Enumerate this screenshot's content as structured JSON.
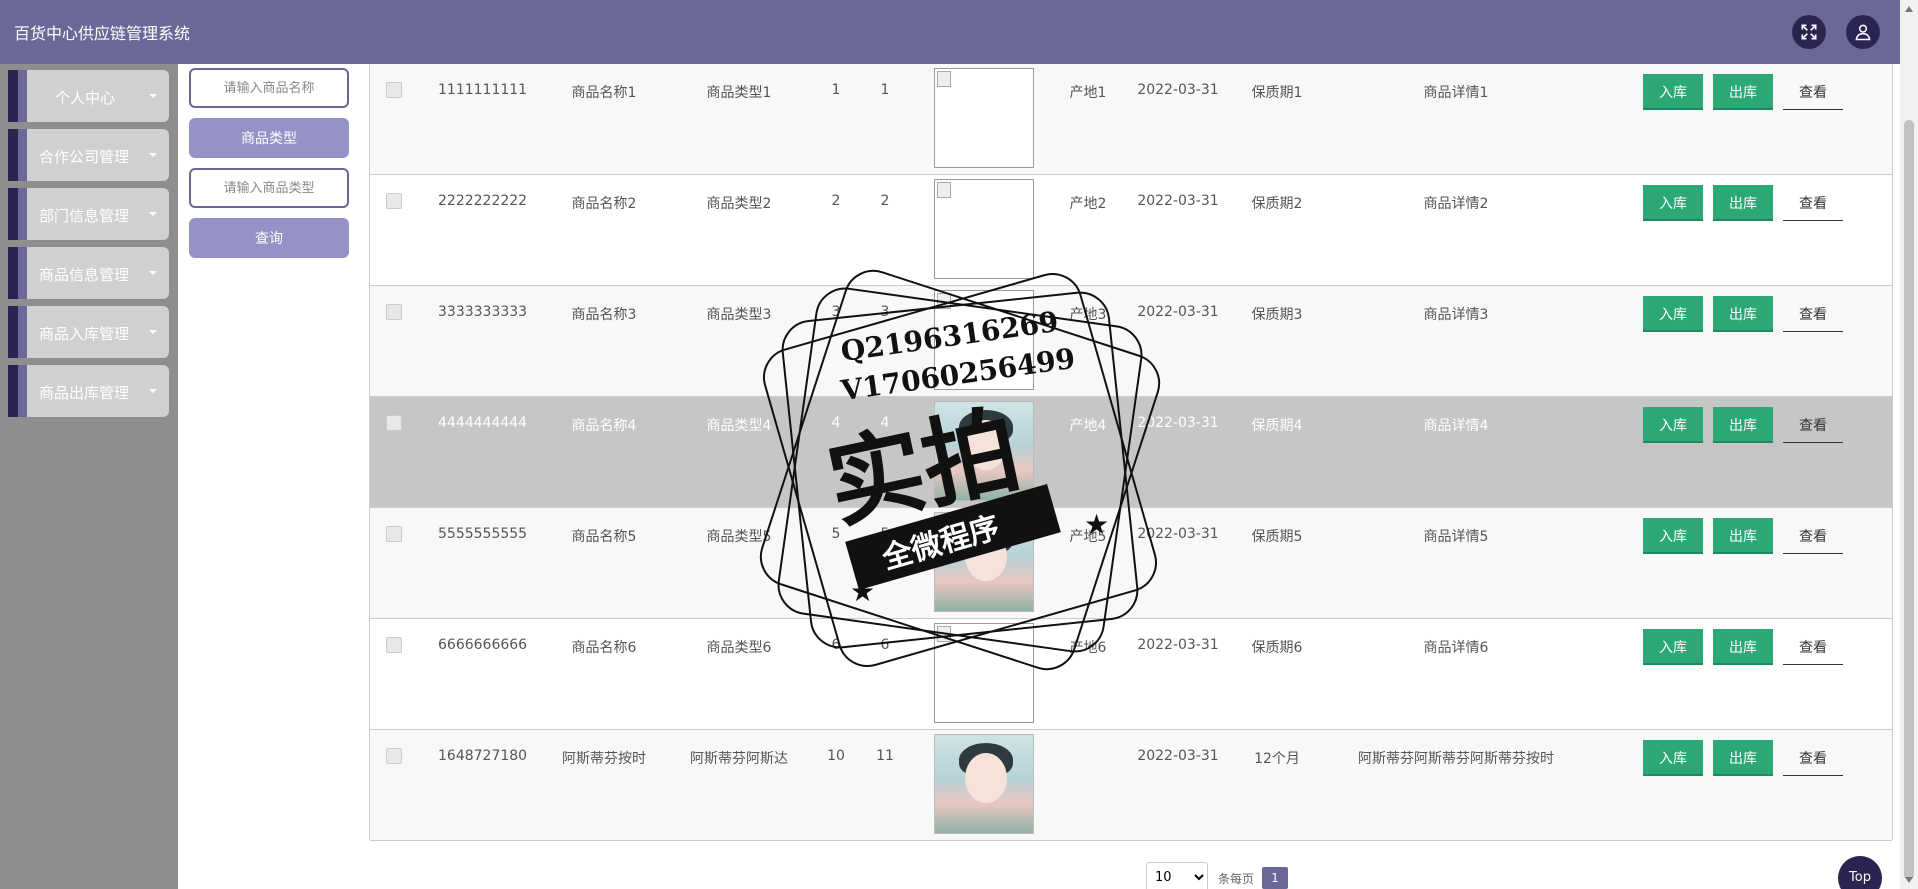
{
  "header": {
    "title": "百货中心供应链管理系统",
    "fullscreen_icon": "expand-icon",
    "user_icon": "user-icon"
  },
  "sidebar": {
    "items": [
      {
        "label": "个人中心"
      },
      {
        "label": "合作公司管理"
      },
      {
        "label": "部门信息管理"
      },
      {
        "label": "商品信息管理"
      },
      {
        "label": "商品入库管理"
      },
      {
        "label": "商品出库管理"
      }
    ]
  },
  "search": {
    "name_placeholder": "请输入商品名称",
    "type_button": "商品类型",
    "type_placeholder": "请输入商品类型",
    "query_button": "查询"
  },
  "table": {
    "rows": [
      {
        "code": "1111111111",
        "name": "商品名称1",
        "type": "商品类型1",
        "a": "1",
        "b": "1",
        "origin": "产地1",
        "date": "2022-03-31",
        "shelf": "保质期1",
        "detail": "商品详情1"
      },
      {
        "code": "2222222222",
        "name": "商品名称2",
        "type": "商品类型2",
        "a": "2",
        "b": "2",
        "origin": "产地2",
        "date": "2022-03-31",
        "shelf": "保质期2",
        "detail": "商品详情2"
      },
      {
        "code": "3333333333",
        "name": "商品名称3",
        "type": "商品类型3",
        "a": "3",
        "b": "3",
        "origin": "产地3",
        "date": "2022-03-31",
        "shelf": "保质期3",
        "detail": "商品详情3"
      },
      {
        "code": "4444444444",
        "name": "商品名称4",
        "type": "商品类型4",
        "a": "4",
        "b": "4",
        "origin": "产地4",
        "date": "2022-03-31",
        "shelf": "保质期4",
        "detail": "商品详情4"
      },
      {
        "code": "5555555555",
        "name": "商品名称5",
        "type": "商品类型5",
        "a": "5",
        "b": "5",
        "origin": "产地5",
        "date": "2022-03-31",
        "shelf": "保质期5",
        "detail": "商品详情5"
      },
      {
        "code": "6666666666",
        "name": "商品名称6",
        "type": "商品类型6",
        "a": "6",
        "b": "6",
        "origin": "产地6",
        "date": "2022-03-31",
        "shelf": "保质期6",
        "detail": "商品详情6"
      },
      {
        "code": "1648727180",
        "name": "阿斯蒂芬按时",
        "type": "阿斯蒂芬阿斯达",
        "a": "10",
        "b": "11",
        "origin": "",
        "date": "2022-03-31",
        "shelf": "12个月",
        "detail": "阿斯蒂芬阿斯蒂芬阿斯蒂芬按时"
      }
    ],
    "actions": {
      "in": "入库",
      "out": "出库",
      "view": "查看"
    }
  },
  "pagination": {
    "page_size": "10",
    "page_size_label": "条每页",
    "current_page": "1"
  },
  "top_button": "Top",
  "watermark": {
    "line1": "Q2196316269",
    "line2": "V17060256499",
    "big": "实拍",
    "banner": "全微程序"
  },
  "colors": {
    "header": "#6b6797",
    "accent_dark": "#2a2550",
    "button_purple": "#9592c6",
    "action_green": "#2ba876",
    "sidebar_bg": "#8e8e8e"
  }
}
